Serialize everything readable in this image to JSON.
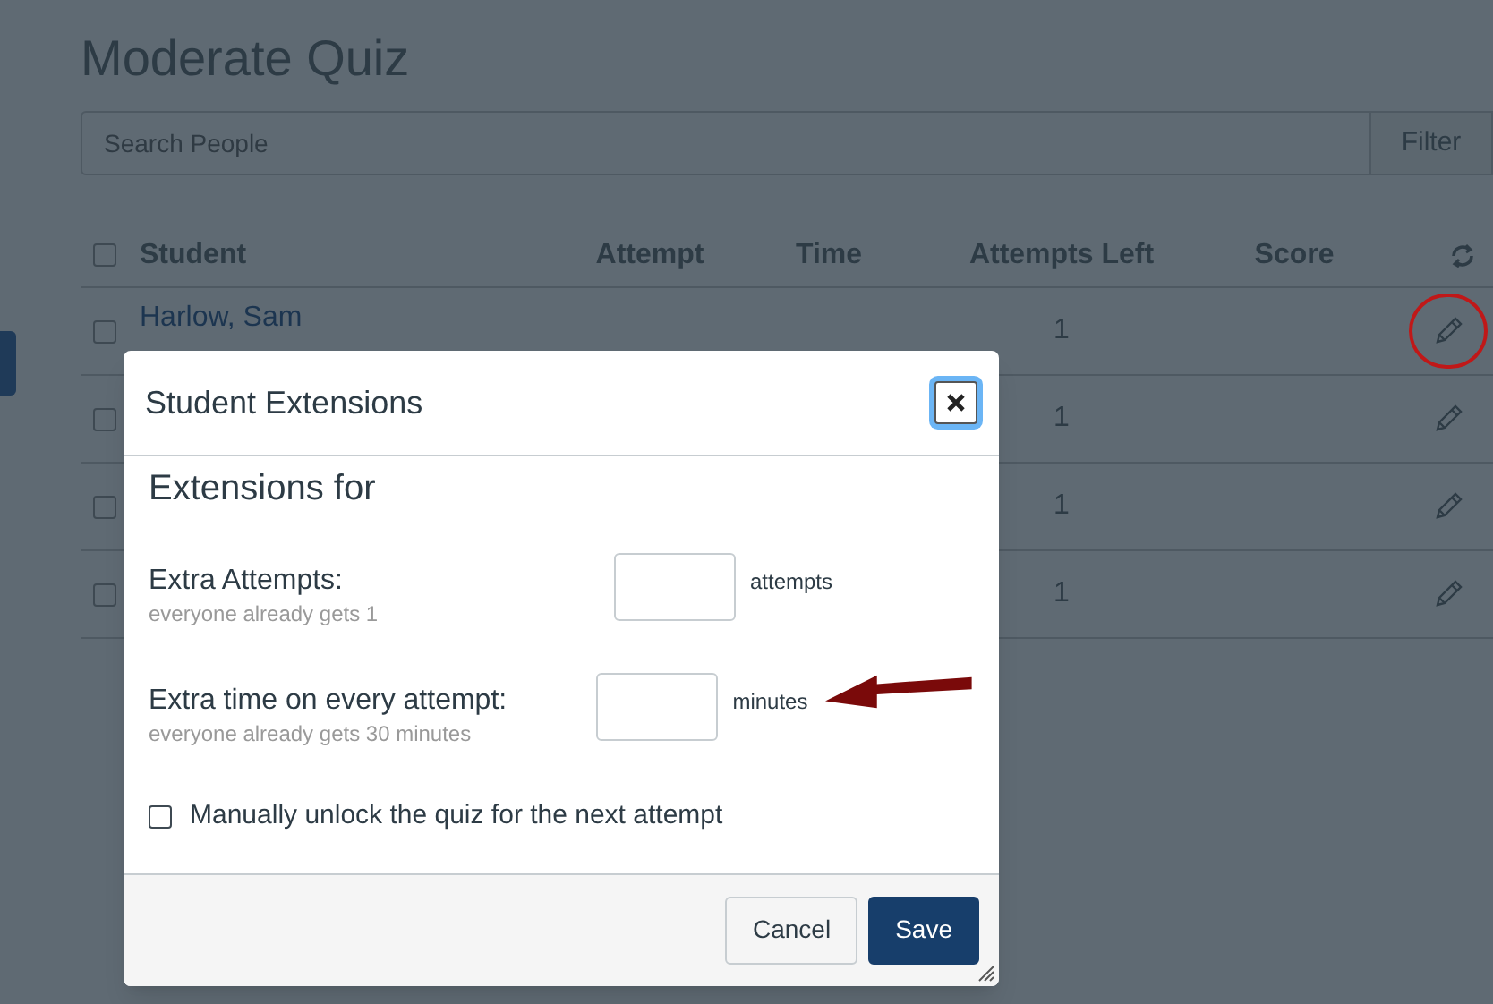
{
  "page": {
    "title": "Moderate Quiz",
    "search": {
      "placeholder": "Search People"
    },
    "filter_button": "Filter"
  },
  "table": {
    "select_all": {
      "checked": false
    },
    "columns": [
      "Student",
      "Attempt",
      "Time",
      "Attempts Left",
      "Score"
    ],
    "rows": [
      {
        "student": "Harlow, Sam",
        "attempts_left": "1",
        "checked": false,
        "highlighted": true
      },
      {
        "attempts_left": "1",
        "checked": false,
        "highlighted": false
      },
      {
        "attempts_left": "1",
        "checked": false,
        "highlighted": false
      },
      {
        "attempts_left": "1",
        "checked": false,
        "highlighted": false
      }
    ]
  },
  "dialog": {
    "title": "Student Extensions",
    "heading": "Extensions for",
    "fields": [
      {
        "label": "Extra Attempts:",
        "hint": "everyone already gets 1",
        "unit": "attempts",
        "arrow": false
      },
      {
        "label": "Extra time on every attempt:",
        "hint": "everyone already gets 30 minutes",
        "unit": "minutes",
        "arrow": true
      }
    ],
    "unlock": {
      "label": "Manually unlock the quiz for the next attempt",
      "checked": false
    },
    "buttons": [
      {
        "label": "Cancel",
        "kind": "secondary"
      },
      {
        "label": "Save",
        "kind": "primary"
      }
    ]
  }
}
